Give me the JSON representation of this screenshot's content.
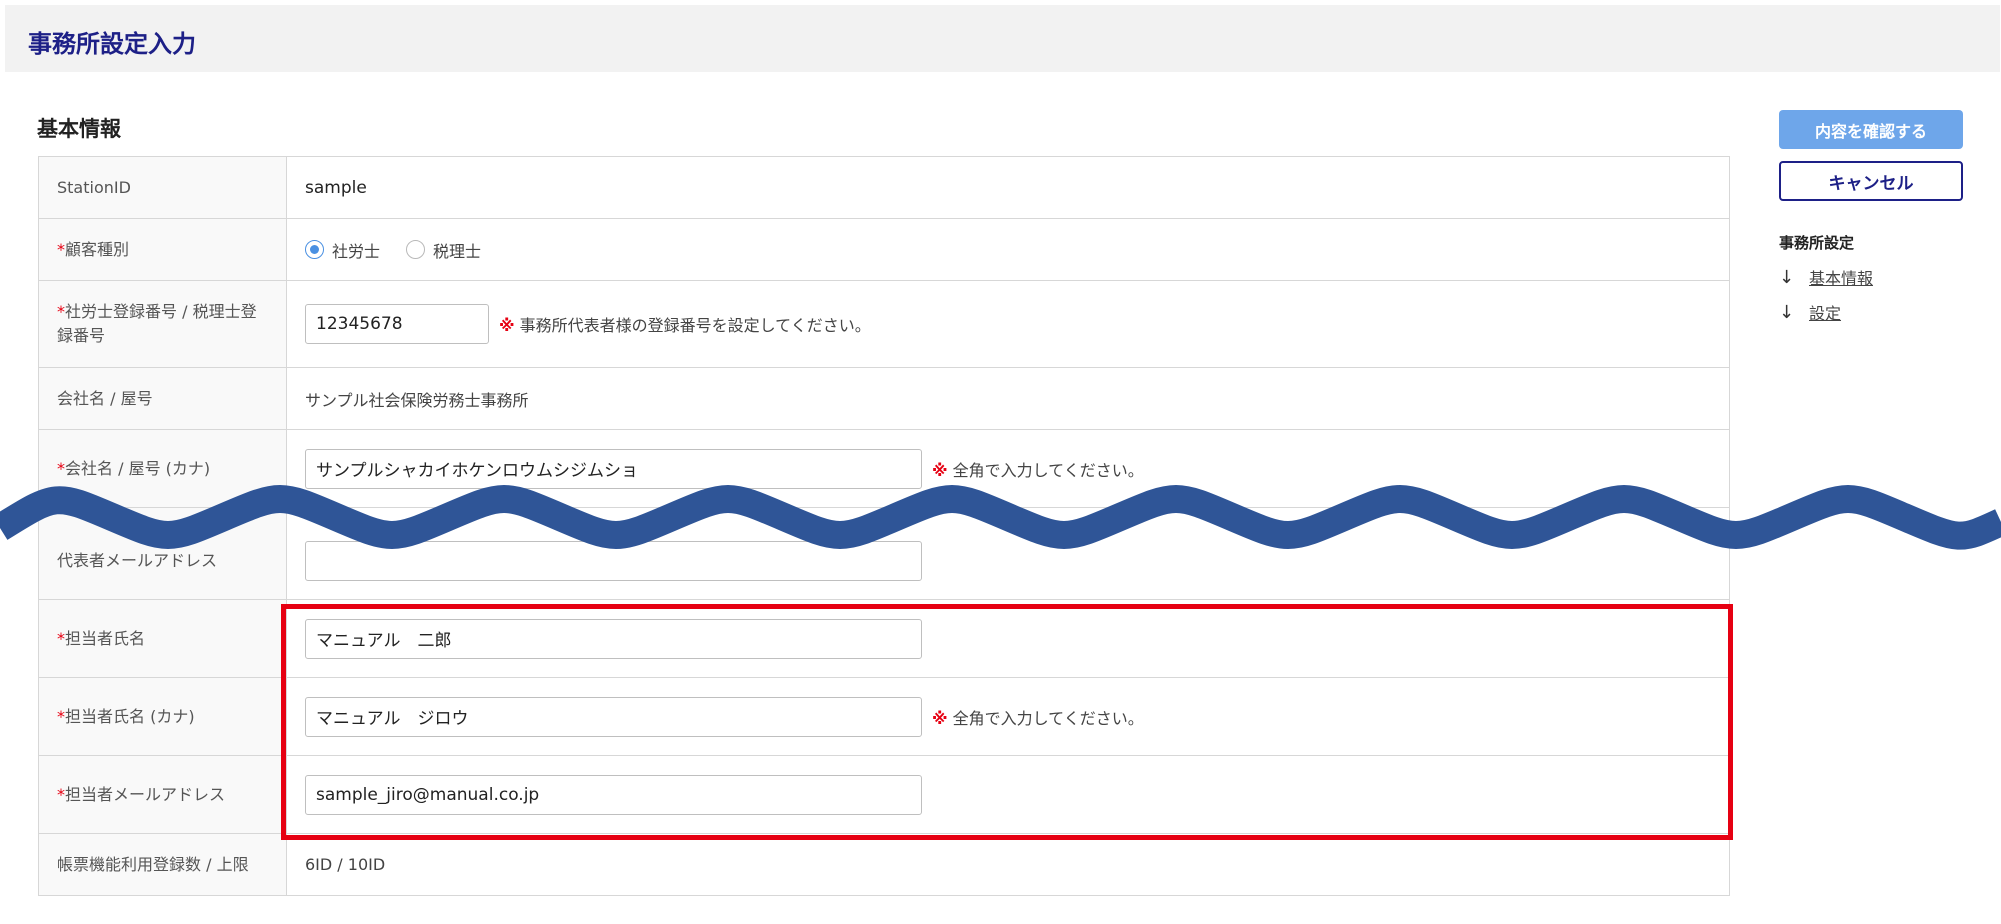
{
  "header": {
    "title": "事務所設定入力"
  },
  "section": {
    "title": "基本情報"
  },
  "rows": {
    "station_id": {
      "label": "StationID",
      "value": "sample"
    },
    "customer_type": {
      "required_mark": "*",
      "label": "顧客種別",
      "options": [
        "社労士",
        "税理士"
      ],
      "selected": "社労士"
    },
    "reg_number": {
      "required_mark": "*",
      "label": "社労士登録番号 / 税理士登録番号",
      "value": "12345678",
      "hint_mark": "※",
      "hint": "事務所代表者様の登録番号を設定してください。"
    },
    "company_name": {
      "label": "会社名 / 屋号",
      "value": "サンプル社会保険労務士事務所"
    },
    "company_kana": {
      "required_mark": "*",
      "label": "会社名 / 屋号 (カナ)",
      "value": "サンプルシャカイホケンロウムシジムショ",
      "hint_mark": "※",
      "hint": "全角で入力してください。"
    },
    "rep_email": {
      "label": "代表者メールアドレス",
      "value": ""
    },
    "contact_name": {
      "required_mark": "*",
      "label": "担当者氏名",
      "value": "マニュアル　二郎"
    },
    "contact_kana": {
      "required_mark": "*",
      "label": "担当者氏名 (カナ)",
      "value": "マニュアル　ジロウ",
      "hint_mark": "※",
      "hint": "全角で入力してください。"
    },
    "contact_email": {
      "required_mark": "*",
      "label": "担当者メールアドレス",
      "value": "sample_jiro@manual.co.jp"
    },
    "form_usage": {
      "label": "帳票機能利用登録数 / 上限",
      "value": "6ID / 10ID"
    }
  },
  "sidebar": {
    "confirm_label": "内容を確認する",
    "cancel_label": "キャンセル",
    "heading": "事務所設定",
    "links": [
      {
        "arrow": "↓",
        "label": "基本情報"
      },
      {
        "arrow": "↓",
        "label": "設定"
      }
    ]
  },
  "colors": {
    "title": "#1d2087",
    "confirm_button": "#6ea6ea",
    "required": "#e60012",
    "highlight_border": "#e60012",
    "wave": "#2f5597"
  }
}
